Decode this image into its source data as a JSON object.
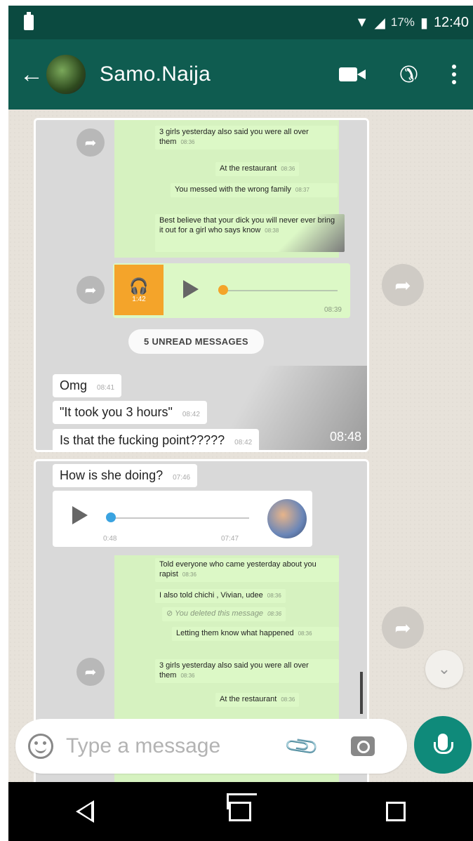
{
  "status_bar": {
    "battery_pct": "17%",
    "time": "12:40"
  },
  "header": {
    "contact_name": "Samo.Naija",
    "back_icon": "arrow-left-icon"
  },
  "screenshot_top": {
    "green_messages": [
      {
        "text": "3 girls yesterday also said you were all over them",
        "time": "08:36"
      },
      {
        "text": "At the restaurant",
        "time": "08:36"
      },
      {
        "text": "You messed with the wrong family",
        "time": "08:37"
      },
      {
        "text": "Best believe that your dick you will never ever bring it out for a girl who says know",
        "time": "08:38"
      }
    ],
    "voice_note": {
      "duration": "1:42",
      "time": "08:39"
    },
    "unread_label": "5 UNREAD MESSAGES",
    "white_messages": [
      {
        "text": "Omg",
        "time": "08:41"
      },
      {
        "text": "\"It took you 3 hours\"",
        "time": "08:42"
      },
      {
        "text": "Is that the fucking point?????",
        "time": "08:42"
      }
    ],
    "overlay_time": "08:48"
  },
  "screenshot_bottom": {
    "white_message": {
      "text": "How is she doing?",
      "time": "07:46"
    },
    "voice_note": {
      "duration": "0:48",
      "time": "07:47"
    },
    "green_messages": [
      {
        "text": "Told everyone who came yesterday about you rapist",
        "time": "08:36"
      },
      {
        "text": "I also told chichi , Vivian, udee",
        "time": "08:36"
      },
      {
        "text": "You deleted this message",
        "time": "08:36"
      },
      {
        "text": "Letting them know what happened",
        "time": "08:36"
      },
      {
        "text": "3 girls yesterday also said you were all over them",
        "time": "08:36"
      },
      {
        "text": "At the restaurant",
        "time": "08:36"
      }
    ]
  },
  "composer": {
    "placeholder": "Type a message"
  },
  "colors": {
    "header": "#0f5c50",
    "status": "#0b4a40",
    "mic": "#0f8a7a",
    "outgoing": "#dcf8c6",
    "voice_thumb": "#f4a42a"
  }
}
